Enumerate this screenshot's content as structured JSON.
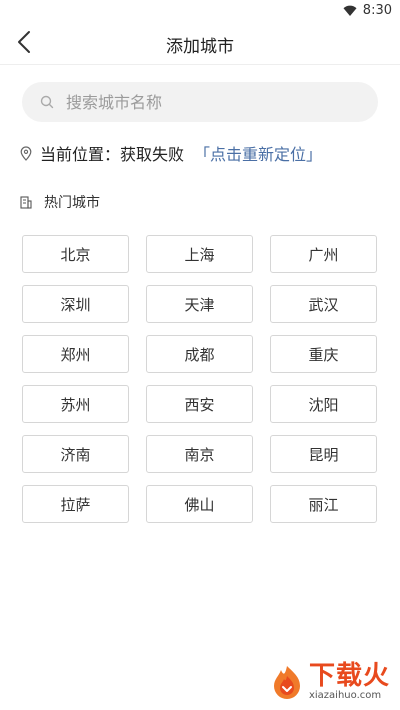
{
  "status_bar": {
    "time": "8:30",
    "wifi_icon": "wifi-icon"
  },
  "app_bar": {
    "title": "添加城市",
    "back_icon": "chevron-left-icon"
  },
  "search": {
    "placeholder": "搜索城市名称",
    "value": ""
  },
  "location": {
    "label": "当前位置：",
    "status": "获取失败",
    "relocate": "「点击重新定位」"
  },
  "hot_cities": {
    "title": "热门城市",
    "cities": [
      "北京",
      "上海",
      "广州",
      "深圳",
      "天津",
      "武汉",
      "郑州",
      "成都",
      "重庆",
      "苏州",
      "西安",
      "沈阳",
      "济南",
      "南京",
      "昆明",
      "拉萨",
      "佛山",
      "丽江"
    ]
  },
  "watermark": {
    "title": "下载火",
    "url": "xiazaihuo.com"
  },
  "colors": {
    "link": "#4a6fa5",
    "search_bg": "#f2f2f2",
    "border": "#d6d6d6",
    "brand": "#e84a1e"
  }
}
